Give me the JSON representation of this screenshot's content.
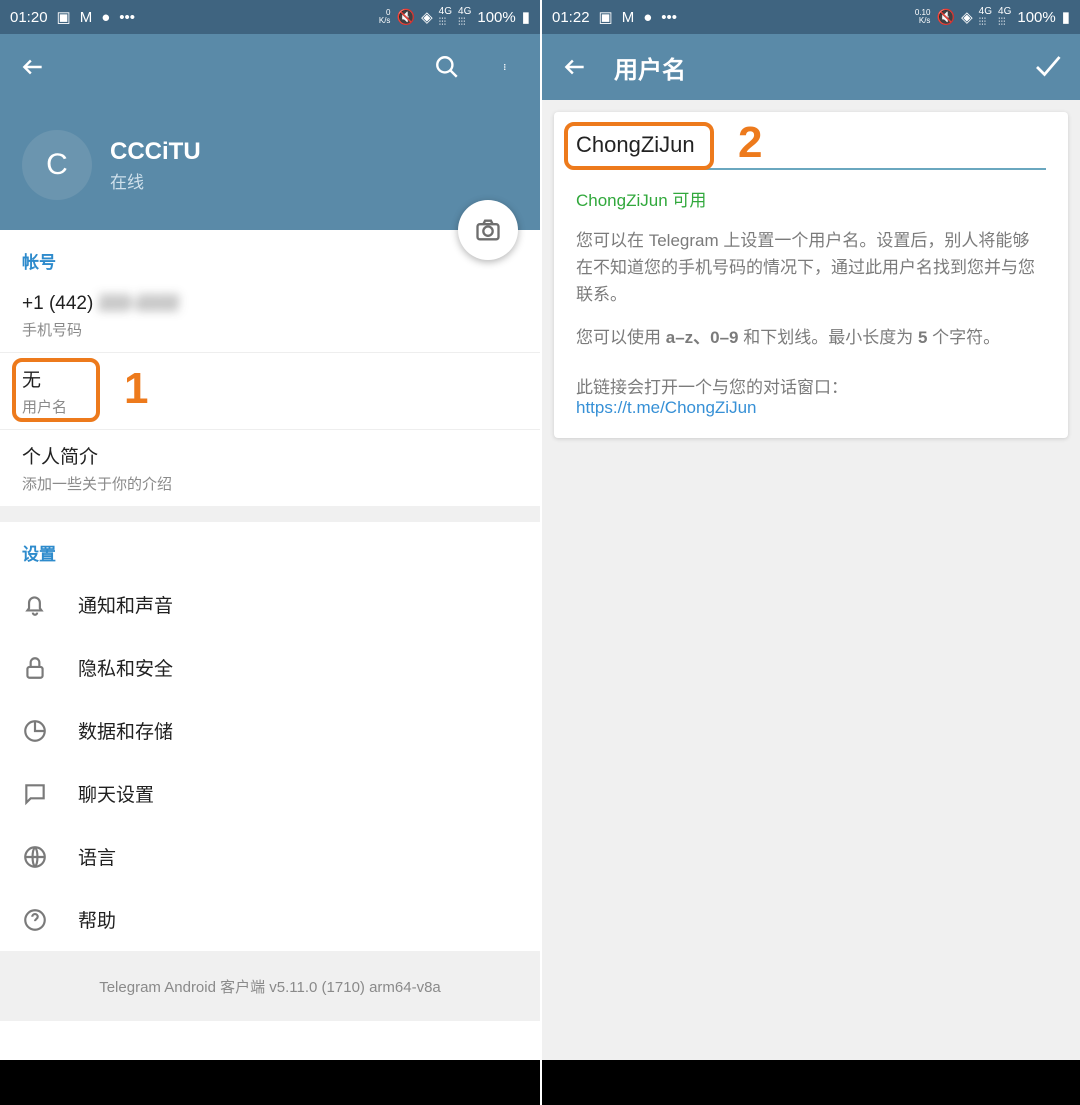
{
  "left": {
    "statusbar": {
      "time": "01:20",
      "netrate_top": "0",
      "netrate_bottom": "K/s",
      "battery": "100%"
    },
    "profile": {
      "initial": "C",
      "name": "CCCiTU",
      "status": "在线"
    },
    "account_section_label": "帐号",
    "phone": {
      "value_prefix": "+1 (442)",
      "value_rest": "222-2222",
      "label": "手机号码"
    },
    "username": {
      "value": "无",
      "label": "用户名"
    },
    "bio": {
      "value": "个人简介",
      "label": "添加一些关于你的介绍"
    },
    "settings_section_label": "设置",
    "settings": {
      "notifications": "通知和声音",
      "privacy": "隐私和安全",
      "data": "数据和存储",
      "chat": "聊天设置",
      "language": "语言",
      "help": "帮助"
    },
    "version": "Telegram Android 客户端 v5.11.0 (1710) arm64-v8a",
    "marker": "1"
  },
  "right": {
    "statusbar": {
      "time": "01:22",
      "netrate_top": "0.10",
      "netrate_bottom": "K/s",
      "battery": "100%"
    },
    "title": "用户名",
    "input_value": "ChongZiJun",
    "available_text": "ChongZiJun 可用",
    "desc1": "您可以在 Telegram 上设置一个用户名。设置后，别人将能够在不知道您的手机号码的情况下，通过此用户名找到您并与您联系。",
    "desc2a": "您可以使用 ",
    "desc2b": "a–z、0–9",
    "desc2c": " 和下划线。最小长度为 ",
    "desc2d": "5",
    "desc2e": " 个字符。",
    "desc3": "此链接会打开一个与您的对话窗口：",
    "link": "https://t.me/ChongZiJun",
    "marker": "2"
  }
}
